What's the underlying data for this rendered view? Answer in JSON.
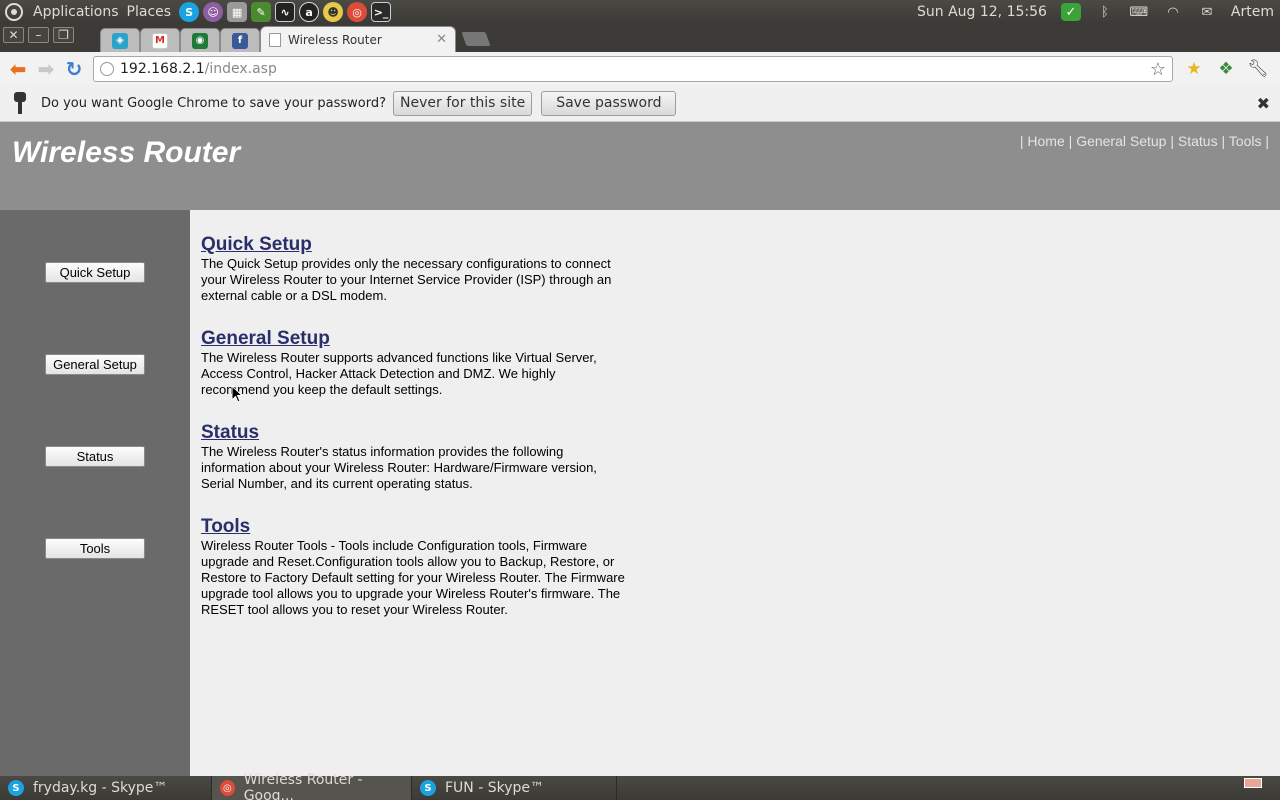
{
  "top_panel": {
    "menu_applications": "Applications",
    "menu_places": "Places",
    "clock": "Sun Aug 12, 15:56",
    "user": "Artem"
  },
  "browser": {
    "active_tab_title": "Wireless Router",
    "url_host": "192.168.2.1",
    "url_path": "/index.asp"
  },
  "infobar": {
    "message": "Do you want Google Chrome to save your password?",
    "never_label": "Never for this site",
    "save_label": "Save password"
  },
  "site": {
    "title": "Wireless Router",
    "top_nav": {
      "home": "Home",
      "general_setup": "General Setup",
      "status": "Status",
      "tools": "Tools"
    },
    "side_nav": {
      "quick_setup": "Quick Setup",
      "general_setup": "General Setup",
      "status": "Status",
      "tools": "Tools"
    },
    "sections": [
      {
        "heading": "Quick Setup",
        "text": "The Quick Setup provides only the necessary configurations to connect your Wireless Router to your Internet Service Provider (ISP) through an external cable or a DSL modem."
      },
      {
        "heading": "General Setup",
        "text": "The Wireless Router supports advanced functions like Virtual Server, Access Control, Hacker Attack Detection and DMZ. We highly recommend you keep the default settings."
      },
      {
        "heading": "Status",
        "text": "The Wireless Router's status information provides the following information about your Wireless Router: Hardware/Firmware version, Serial Number, and its current operating status."
      },
      {
        "heading": "Tools",
        "text": "Wireless Router Tools - Tools include Configuration tools, Firmware upgrade and Reset.Configuration tools allow you to Backup, Restore, or Restore to Factory Default setting for your Wireless Router. The Firmware upgrade tool allows you to upgrade your Wireless Router's firmware. The RESET tool allows you to reset your Wireless Router."
      }
    ]
  },
  "taskbar": {
    "task1": "fryday.kg - Skype™",
    "task2": "Wireless Router - Goog...",
    "task3": "FUN - Skype™"
  },
  "colors": {
    "header_bg": "#8e8e8e",
    "sidebar_bg": "#6a6a6a",
    "heading_link": "#2a2e6a",
    "ubuntu_panel": "#3c3b37"
  }
}
